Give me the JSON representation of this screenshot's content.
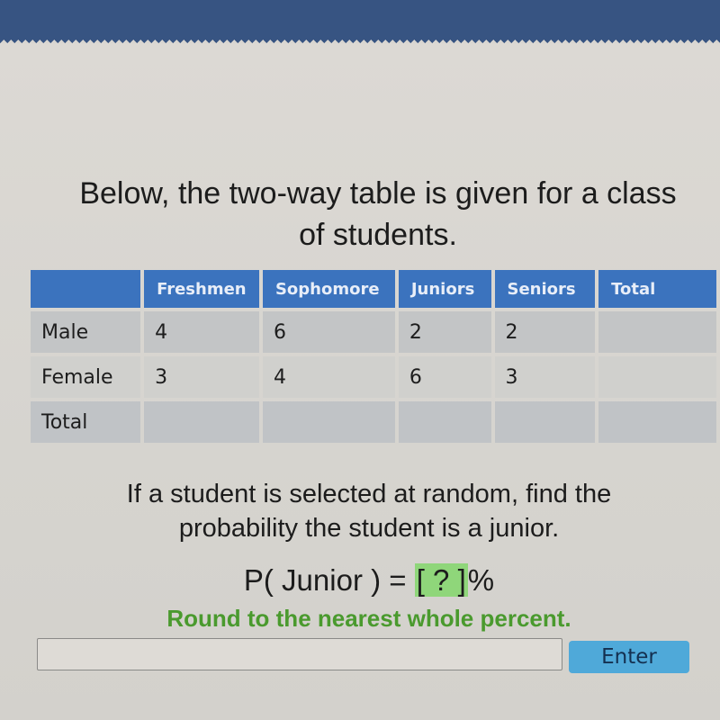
{
  "intro": {
    "line1": "Below, the two-way table is given for a class",
    "line2": "of students."
  },
  "table": {
    "headers": [
      "",
      "Freshmen",
      "Sophomore",
      "Juniors",
      "Seniors",
      "Total"
    ],
    "rows": [
      {
        "label": "Male",
        "cells": [
          "4",
          "6",
          "2",
          "2",
          ""
        ]
      },
      {
        "label": "Female",
        "cells": [
          "3",
          "4",
          "6",
          "3",
          ""
        ]
      },
      {
        "label": "Total",
        "cells": [
          "",
          "",
          "",
          "",
          ""
        ]
      }
    ]
  },
  "question": {
    "line1": "If a student is selected at random, find the",
    "line2": "probability the student is a junior."
  },
  "formula": {
    "prefix": "P( Junior ) = ",
    "blank": "[ ? ]",
    "suffix": "%"
  },
  "hint": "Round to the nearest whole percent.",
  "answer_input": {
    "value": "",
    "placeholder": ""
  },
  "enter_button": "Enter"
}
